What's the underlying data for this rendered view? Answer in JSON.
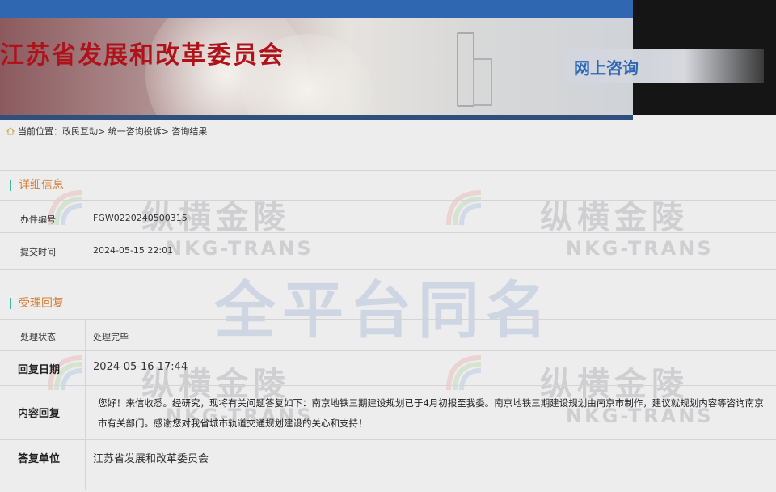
{
  "header": {
    "org_title": "江苏省发展和改革委员会",
    "online_consult": "网上咨询"
  },
  "breadcrumb": {
    "label": "当前位置：",
    "path": "政民互动> 统一咨询投诉> 咨询结果"
  },
  "details": {
    "section_title": "详细信息",
    "rows": [
      {
        "label": "办件编号",
        "value": "FGW0220240500315"
      },
      {
        "label": "提交时间",
        "value": "2024-05-15 22:01"
      }
    ]
  },
  "reply": {
    "section_title": "受理回复",
    "status_label": "处理状态",
    "status_value": "处理完毕",
    "date_label": "回复日期",
    "date_value": "2024-05-16 17:44",
    "content_label": "内容回复",
    "content_value": "您好！来信收悉。经研究，现将有关问题答复如下：南京地铁三期建设规划已于4月初报至我委。南京地铁三期建设规划由南京市制作，建议就规划内容等咨询南京市有关部门。感谢您对我省城市轨道交通规划建设的关心和支持！",
    "unit_label": "答复单位",
    "unit_value": "江苏省发展和改革委员会"
  },
  "watermark": {
    "cn": "纵横金陵",
    "en": "NKG-TRANS",
    "center": "全平台同名"
  },
  "colors": {
    "topbar_blue": "#2f67b1",
    "title_red": "#b0121a",
    "section_orange": "#d9823a",
    "section_bar_teal": "#3cb8a2"
  }
}
